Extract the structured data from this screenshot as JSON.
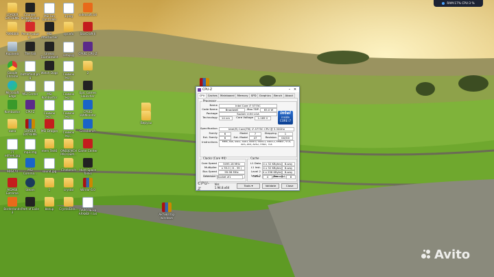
{
  "tray": {
    "label": "RAM:17%  CPU:3 %"
  },
  "watermark": {
    "text": "Avito"
  },
  "desktop_icons": [
    {
      "label": "LOADER EXTREME",
      "kind": "folder"
    },
    {
      "label": "Counter-Strike Global Offe...",
      "kind": "dark"
    },
    {
      "label": "MSI Fan Controller",
      "kind": "doc"
    },
    {
      "label": "1.png",
      "kind": "doc"
    },
    {
      "label": "videosoft.txt",
      "kind": "orange"
    },
    {
      "label": "7896800",
      "kind": "folder"
    },
    {
      "label": "Регистрация...",
      "kind": "pdf"
    },
    {
      "label": "MSI Afterburner",
      "kind": "dark"
    },
    {
      "label": "sysinfo",
      "kind": "folder"
    },
    {
      "label": "StarCraft II",
      "kind": "red"
    },
    {
      "label": "Корзина",
      "kind": "bin"
    },
    {
      "label": "The Fall",
      "kind": "dark"
    },
    {
      "label": "Unreal Tournament",
      "kind": "dark"
    },
    {
      "label": "setup.g",
      "kind": "doc"
    },
    {
      "label": "CPUID CPU-Z",
      "kind": "purple"
    },
    {
      "label": "Google Chrome",
      "kind": "chrome"
    },
    {
      "label": "battlefield.png",
      "kind": "doc"
    },
    {
      "label": "Watch Dogs",
      "kind": "dark"
    },
    {
      "label": "Снимок экр...",
      "kind": "doc"
    },
    {
      "label": "2",
      "kind": "folder"
    },
    {
      "label": "Microsoft Edge",
      "kind": "edge"
    },
    {
      "label": "MSI Center",
      "kind": "doc"
    },
    {
      "label": "MSI Kombustor",
      "kind": "doc"
    },
    {
      "label": "Снимок экр...",
      "kind": "doc"
    },
    {
      "label": "Epic Games Launcher",
      "kind": "dark"
    },
    {
      "label": "Kombustor",
      "kind": "green"
    },
    {
      "label": "CPU-Z",
      "kind": "purple"
    },
    {
      "label": "Снимок экр...",
      "kind": "doc"
    },
    {
      "label": "Снимок экр...",
      "kind": "doc"
    },
    {
      "label": "CPUID HWMonitor",
      "kind": "blue"
    },
    {
      "label": "ника",
      "kind": "folder"
    },
    {
      "label": "LOADER EXTREME",
      "kind": "rar"
    },
    {
      "label": "MSI Dragon",
      "kind": "red"
    },
    {
      "label": "Снимок экр...",
      "kind": "doc"
    },
    {
      "label": "Geekbench",
      "kind": "blue"
    },
    {
      "label": "77 edfvek.jpg",
      "kind": "doc"
    },
    {
      "label": "mp3.img",
      "kind": "doc"
    },
    {
      "label": "mem Test6",
      "kind": "folder"
    },
    {
      "label": "ONEBENCH PRO DEM...",
      "kind": "folder"
    },
    {
      "label": "Game Center",
      "kind": "red"
    },
    {
      "label": "906470",
      "kind": "doc"
    },
    {
      "label": "MSI Comma...",
      "kind": "blue"
    },
    {
      "label": "sound.jpg",
      "kind": "doc"
    },
    {
      "label": "Cinebench",
      "kind": "folder"
    },
    {
      "label": "Hunt Space Tanks",
      "kind": "dark"
    },
    {
      "label": "AIDA64 Extreme",
      "kind": "red"
    },
    {
      "label": "Steam",
      "kind": "steam"
    },
    {
      "label": "1",
      "kind": "folder"
    },
    {
      "label": "crystal",
      "kind": "folder"
    },
    {
      "label": "Winrar 6.0",
      "kind": "rar"
    },
    {
      "label": "Borderlands 3",
      "kind": "orange"
    },
    {
      "label": "Path of Exile",
      "kind": "dark"
    },
    {
      "label": "bkeup",
      "kind": "folder"
    },
    {
      "label": "CrystalDisk...",
      "kind": "folder"
    },
    {
      "label": "ПАРОЛЬ на АРХИВ!!!.txt",
      "kind": "doc"
    }
  ],
  "desktop_extra": [
    {
      "label": "",
      "kind": "rar"
    },
    {
      "label": "",
      "kind": "folder"
    },
    {
      "label": "Вирусы",
      "kind": "folder"
    },
    {
      "label": "Активатор windows",
      "kind": "rar"
    }
  ],
  "cpuz": {
    "title": "CPU-Z",
    "tabs": [
      "CPU",
      "Caches",
      "Mainboard",
      "Memory",
      "SPD",
      "Graphics",
      "Bench",
      "About"
    ],
    "processor_title": "Processor",
    "labels": {
      "name": "Name",
      "codename": "Code Name",
      "maxtdp": "Max TDP",
      "package": "Package",
      "technology": "Technology",
      "corevoltage": "Core Voltage",
      "specification": "Specification",
      "family": "Family",
      "model": "Model",
      "stepping": "Stepping",
      "extfamily": "Ext. Family",
      "extmodel": "Ext. Model",
      "revision": "Revision",
      "instructions": "Instructions"
    },
    "values": {
      "name": "Intel Core i7 5775C",
      "codename": "Broadwell",
      "maxtdp": "65.0 W",
      "package": "Socket 1150 LGA",
      "technology": "14 nm",
      "corevoltage": "1.169 V",
      "specification": "Intel(R) Core(TM) i7-5775C CPU @ 3.30GHz",
      "family": "6",
      "model": "7",
      "stepping": "1",
      "extfamily": "6",
      "extmodel": "47",
      "revision": "G0/G0",
      "instructions_1": "MMX, SSE, SSE2, SSE3, SSSE3, SSE4.1, SSE4.2, EM64T, VT-x,",
      "instructions_2": "AES, AVX, AVX2, FMA3, TSX"
    },
    "intel_badge": {
      "brand": "intel",
      "line1": "inside",
      "line2": "CORE i7"
    },
    "clocks_title": "Clocks (Core #0)",
    "clock_labels": {
      "corespeed": "Core Speed",
      "multiplier": "Multiplier",
      "busspeed": "Bus Speed",
      "ratedfsb": "Rated FSB"
    },
    "clock_values": {
      "corespeed": "3495.18 MHz",
      "multiplier": "x 35.0 ( 8 - 39 )",
      "busspeed": "99.98 MHz",
      "ratedfsb": ""
    },
    "cache_title": "Cache",
    "cache_rows": [
      {
        "label": "L1 Data",
        "size": "4 x 32 KBytes",
        "way": "8-way"
      },
      {
        "label": "L1 Inst.",
        "size": "4 x 32 KBytes",
        "way": "8-way"
      },
      {
        "label": "Level 2",
        "size": "4 x 256 KBytes",
        "way": "8-way"
      },
      {
        "label": "Level 3",
        "size": "6 MBytes",
        "way": "12-way"
      }
    ],
    "selection_label": "Selection",
    "selection_value": "Socket #1",
    "cores_label": "Cores",
    "cores_value": "4",
    "threads_label": "Threads",
    "threads_value": "8",
    "footer_logo": "CPU-Z",
    "version": "Ver. 1.94.8.x64",
    "tools_label": "Tools",
    "validate_label": "Validate",
    "close_label": "Close"
  }
}
